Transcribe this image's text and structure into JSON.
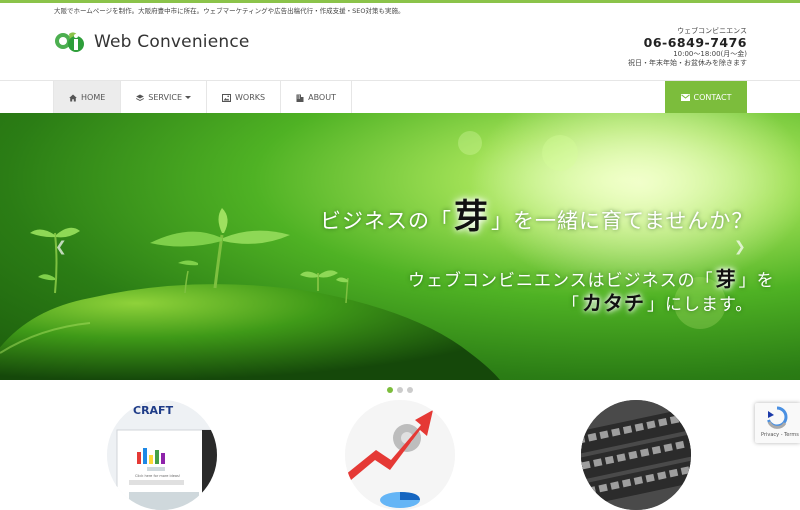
{
  "top_bar": {
    "tagline": "大阪でホームページを制作。大阪府豊中市に所在。ウェブマーケティングや広告出稿代行・作成支援・SEO対策も実施。"
  },
  "header": {
    "logo_text": "Web Convenience",
    "company": "ウェブコンビニエンス",
    "phone": "06-6849-7476",
    "hours": "10:00～18:00(月～金)",
    "holiday": "祝日・年末年始・お盆休みを除きます"
  },
  "nav": {
    "home": "HOME",
    "service": "SERVICE",
    "works": "WORKS",
    "about": "ABOUT",
    "contact": "CONTACT"
  },
  "hero": {
    "line1_pre": "ビジネスの「",
    "line1_kanji": "芽",
    "line1_post": "」を一緒に育てませんか？",
    "line2_pre": "ウェブコンビニエンスはビジネスの「",
    "line2_kanji": "芽",
    "line2_post": "」を",
    "line3_pre": "「",
    "line3_word": "カタチ",
    "line3_post": "」にします。",
    "prev_arrow": "❮",
    "next_arrow": "❯"
  },
  "carousel": {
    "slide_count": 3,
    "active_index": 0
  },
  "thumbs": {
    "craft_label": "CRAFT",
    "craft_caption": "Click here for more ideas!"
  },
  "recaptcha": {
    "links": "Privacy - Terms"
  },
  "colors": {
    "accent": "#7cbd3c",
    "top_line": "#8bc34a"
  }
}
